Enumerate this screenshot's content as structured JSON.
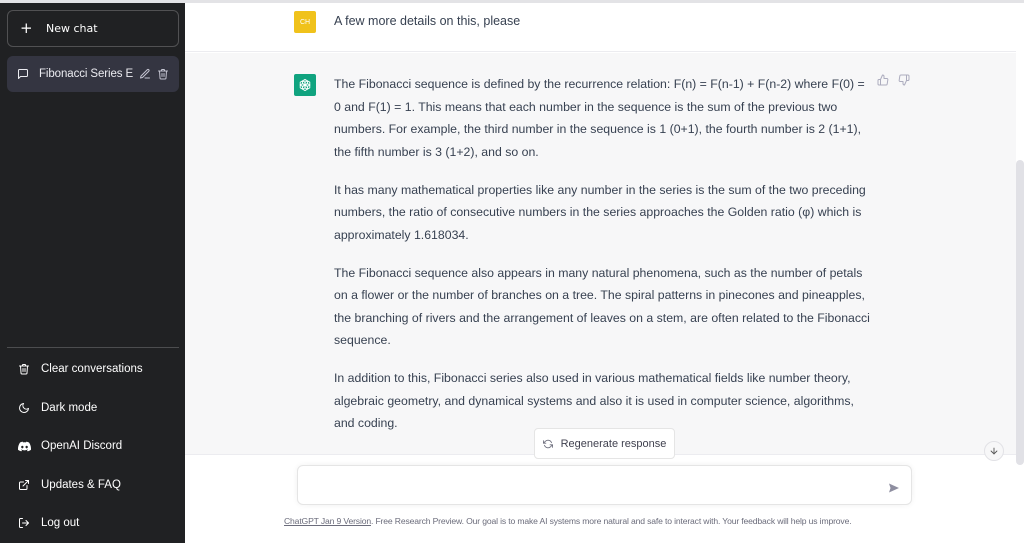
{
  "sidebar": {
    "new_chat_label": "New chat",
    "conversations": [
      {
        "title": "Fibonacci Series Ex",
        "icon": "chat-bubble-icon"
      }
    ],
    "menu": [
      {
        "label": "Clear conversations",
        "icon": "trash-icon"
      },
      {
        "label": "Dark mode",
        "icon": "moon-icon"
      },
      {
        "label": "OpenAI Discord",
        "icon": "discord-icon"
      },
      {
        "label": "Updates & FAQ",
        "icon": "external-link-icon"
      },
      {
        "label": "Log out",
        "icon": "logout-icon"
      }
    ]
  },
  "chat": {
    "user_message": {
      "avatar_initials": "CH",
      "avatar_color": "#f0c21b",
      "text": "A few more details on this, please"
    },
    "assistant_message": {
      "avatar_color": "#10a37f",
      "paragraphs": [
        "The Fibonacci sequence is defined by the recurrence relation: F(n) = F(n-1) + F(n-2) where F(0) = 0 and F(1) = 1. This means that each number in the sequence is the sum of the previous two numbers. For example, the third number in the sequence is 1 (0+1), the fourth number is 2 (1+1), the fifth number is 3 (1+2), and so on.",
        "It has many mathematical properties like any number in the series is the sum of the two preceding numbers, the ratio of consecutive numbers in the series approaches the Golden ratio (φ) which is approximately 1.618034.",
        "The Fibonacci sequence also appears in many natural phenomena, such as the number of petals on a flower or the number of branches on a tree. The spiral patterns in pinecones and pineapples, the branching of rivers and the arrangement of leaves on a stem, are often related to the Fibonacci sequence.",
        "In addition to this, Fibonacci series also used in various mathematical fields like number theory, algebraic geometry, and dynamical systems and also it is used in computer science, algorithms, and coding."
      ]
    },
    "regenerate_label": "Regenerate response"
  },
  "composer": {
    "value": "",
    "placeholder": ""
  },
  "footer": {
    "version_link": "ChatGPT Jan 9 Version",
    "text": ". Free Research Preview. Our goal is to make AI systems more natural and safe to interact with. Your feedback will help us improve."
  }
}
